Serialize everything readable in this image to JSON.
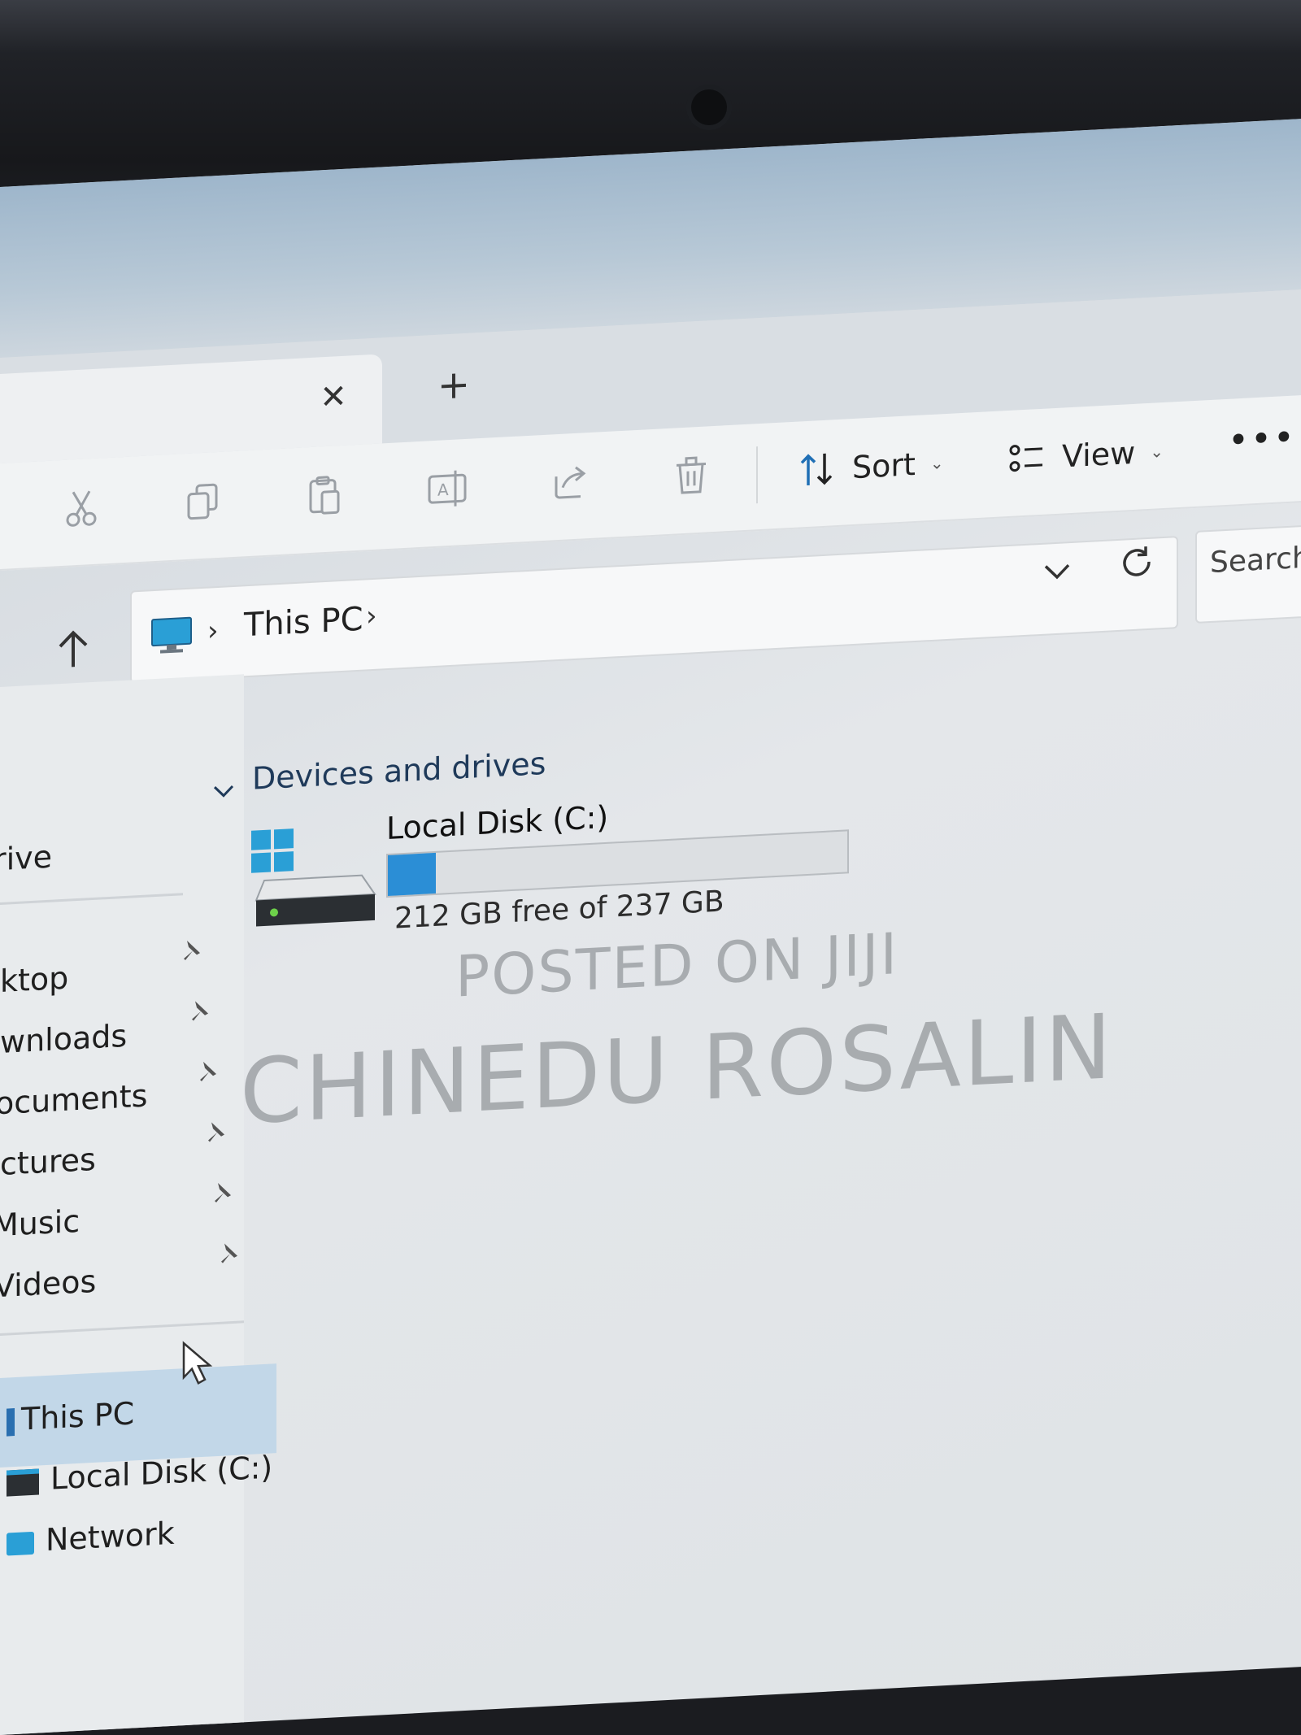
{
  "tabs": {
    "close_glyph": "✕",
    "new_tab_glyph": "+"
  },
  "toolbar": {
    "tools": [
      "cut-icon",
      "copy-icon",
      "paste-icon",
      "rename-icon",
      "share-icon",
      "delete-icon"
    ],
    "sort_label": "Sort",
    "view_label": "View",
    "more_glyph": "•••"
  },
  "address": {
    "crumbs": [
      "This PC"
    ],
    "separator": "›"
  },
  "search": {
    "placeholder": "Search T"
  },
  "nav": {
    "items": [
      {
        "label": "Drive",
        "partial": "rive"
      },
      {
        "label": "Desktop",
        "partial": "ktop"
      },
      {
        "label": "Downloads",
        "partial": "wnloads"
      },
      {
        "label": "Documents",
        "partial": "ocuments"
      },
      {
        "label": "Pictures",
        "partial": "ctures"
      },
      {
        "label": "Music",
        "partial": "Music"
      },
      {
        "label": "Videos",
        "partial": "Videos"
      }
    ],
    "this_pc": "This PC",
    "local_disk": "Local Disk (C:)",
    "network": "Network"
  },
  "content": {
    "group_title": "Devices and drives",
    "drive": {
      "name": "Local Disk (C:)",
      "free_text": "212 GB free of 237 GB",
      "used_fraction": 0.105
    }
  },
  "watermark": {
    "line1": "POSTED ON JIJI",
    "line2": "CHINEDU ROSALIN"
  },
  "colors": {
    "accent": "#2b8ed6",
    "selected_bg": "#c2d7e8"
  }
}
